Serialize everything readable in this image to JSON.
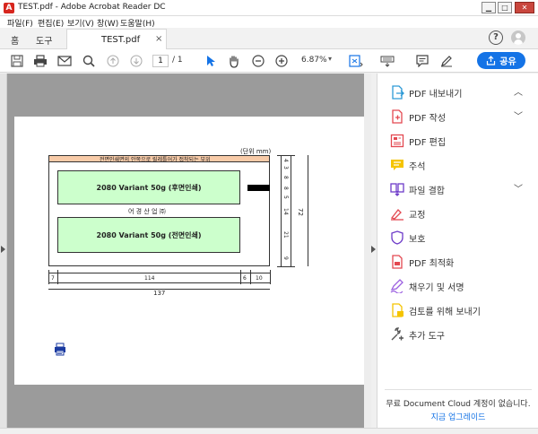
{
  "window": {
    "title": "TEST.pdf - Adobe Acrobat Reader DC",
    "app_icon": "acrobat-icon"
  },
  "menu": [
    {
      "label": "파일(F)"
    },
    {
      "label": "편집(E)"
    },
    {
      "label": "보기(V)"
    },
    {
      "label": "창(W)"
    },
    {
      "label": "도움말(H)"
    }
  ],
  "tabs": {
    "home": "홈",
    "tools": "도구",
    "document": "TEST.pdf",
    "close_glyph": "×"
  },
  "toolbar": {
    "page_current": "1",
    "page_total": "/  1",
    "zoom": "6.87%",
    "share_label": "공유"
  },
  "drawing": {
    "unit_label": "(단위 mm)",
    "top_band_text": "전면인쇄면의 안쪽으로 릴레틀어가 접착되는 부위",
    "box_top_label": "2080  Variant 50g  (후면인쇄)",
    "middle_text": "어 경 산 업 ㈜",
    "box_bottom_label": "2080  Variant 50g  (전면인쇄)",
    "right_dims": [
      "4",
      "3",
      "8",
      "8",
      "5",
      "14",
      "21",
      "9"
    ],
    "total_height": "72",
    "bottom_dims": [
      "7",
      "114",
      "6",
      "10"
    ],
    "total_width": "137"
  },
  "right_panel": {
    "items": [
      {
        "label": "PDF 내보내기",
        "icon": "export-pdf-icon",
        "color": "#2e9ad6",
        "chevron": "︿"
      },
      {
        "label": "PDF 작성",
        "icon": "create-pdf-icon",
        "color": "#e34850",
        "chevron": "﹀"
      },
      {
        "label": "PDF 편집",
        "icon": "edit-pdf-icon",
        "color": "#e34850",
        "chevron": ""
      },
      {
        "label": "주석",
        "icon": "comment-icon",
        "color": "#f5c400",
        "chevron": ""
      },
      {
        "label": "파일 결합",
        "icon": "combine-files-icon",
        "color": "#6e3cc9",
        "chevron": "﹀"
      },
      {
        "label": "교정",
        "icon": "redact-icon",
        "color": "#e34850",
        "chevron": ""
      },
      {
        "label": "보호",
        "icon": "protect-icon",
        "color": "#6e3cc9",
        "chevron": ""
      },
      {
        "label": "PDF 최적화",
        "icon": "optimize-pdf-icon",
        "color": "#e34850",
        "chevron": ""
      },
      {
        "label": "채우기 및 서명",
        "icon": "fill-sign-icon",
        "color": "#9b5fe0",
        "chevron": ""
      },
      {
        "label": "검토를 위해 보내기",
        "icon": "send-review-icon",
        "color": "#f5c400",
        "chevron": ""
      },
      {
        "label": "추가 도구",
        "icon": "more-tools-icon",
        "color": "#555555",
        "chevron": ""
      }
    ],
    "promo_text": "무료 Document Cloud 계정이 없습니다.",
    "upgrade_link": "지금 업그레이드"
  },
  "colors": {
    "accent": "#1473e6",
    "box_fill": "#ccffcc",
    "band_fill": "#f8cba8"
  }
}
